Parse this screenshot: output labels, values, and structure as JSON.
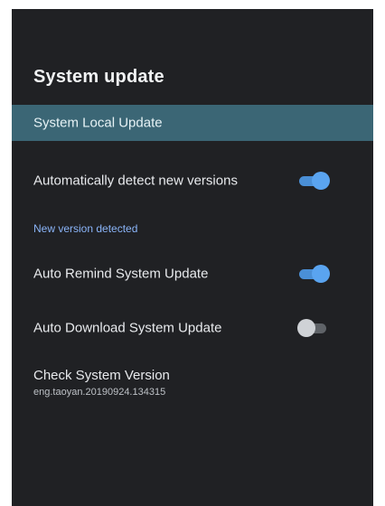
{
  "page": {
    "title": "System update"
  },
  "items": {
    "local_update": {
      "label": "System Local Update",
      "selected": true
    },
    "auto_detect": {
      "label": "Automatically detect new versions",
      "enabled": true
    },
    "new_version_header": "New version detected",
    "auto_remind": {
      "label": "Auto Remind System Update",
      "enabled": true
    },
    "auto_download": {
      "label": "Auto Download System Update",
      "enabled": false
    },
    "check_version": {
      "label": "Check System Version",
      "value": "eng.taoyan.20190924.134315"
    }
  },
  "colors": {
    "background": "#202124",
    "selected_row": "#3b6675",
    "accent": "#4a8fd6",
    "section_header": "#8ab4f8"
  },
  "icons": {
    "toggle_on": "toggle-on-icon",
    "toggle_off": "toggle-off-icon"
  }
}
